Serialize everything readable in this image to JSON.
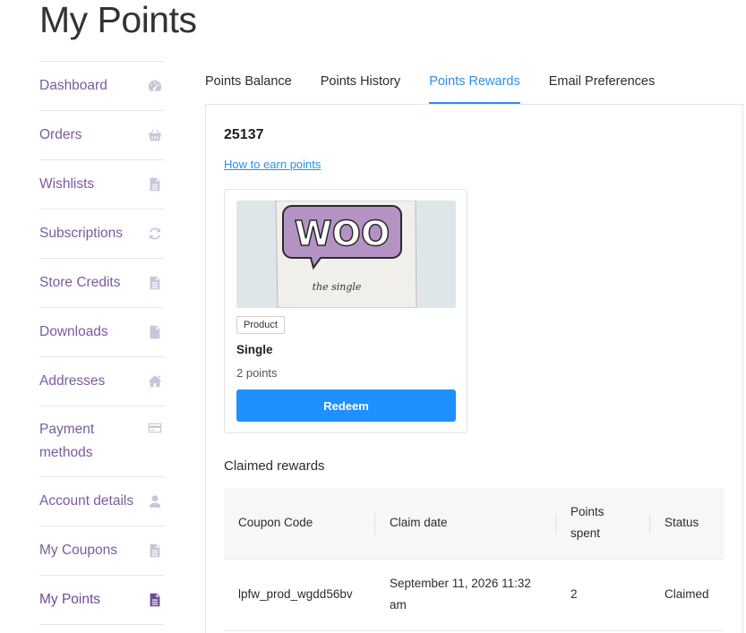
{
  "page": {
    "title": "My Points"
  },
  "sidebar": {
    "items": [
      {
        "label": "Dashboard",
        "icon": "dashboard-icon"
      },
      {
        "label": "Orders",
        "icon": "basket-icon"
      },
      {
        "label": "Wishlists",
        "icon": "document-icon"
      },
      {
        "label": "Subscriptions",
        "icon": "refresh-icon"
      },
      {
        "label": "Store Credits",
        "icon": "document-icon"
      },
      {
        "label": "Downloads",
        "icon": "file-download-icon"
      },
      {
        "label": "Addresses",
        "icon": "home-icon"
      },
      {
        "label": "Payment methods",
        "icon": "credit-card-icon"
      },
      {
        "label": "Account details",
        "icon": "user-icon"
      },
      {
        "label": "My Coupons",
        "icon": "document-icon"
      },
      {
        "label": "My Points",
        "icon": "document-icon",
        "active": true
      }
    ]
  },
  "tabs": [
    {
      "label": "Points Balance"
    },
    {
      "label": "Points History"
    },
    {
      "label": "Points Rewards",
      "active": true
    },
    {
      "label": "Email Preferences"
    }
  ],
  "rewards": {
    "balance": "25137",
    "earn_link": "How to earn points",
    "card": {
      "image_text": "WOO",
      "image_subtext": "the single",
      "badge": "Product",
      "name": "Single",
      "points": "2 points",
      "button": "Redeem"
    },
    "claimed_title": "Claimed rewards",
    "table": {
      "headers": [
        "Coupon Code",
        "Claim date",
        "Points spent",
        "Status"
      ],
      "rows": [
        [
          "lpfw_prod_wgdd56bv",
          "September 11, 2026 11:32 am",
          "2",
          "Claimed"
        ]
      ]
    }
  },
  "colors": {
    "accent": "#2d8fe8",
    "nav_link": "#7a5b9e",
    "button": "#1e90ff"
  }
}
